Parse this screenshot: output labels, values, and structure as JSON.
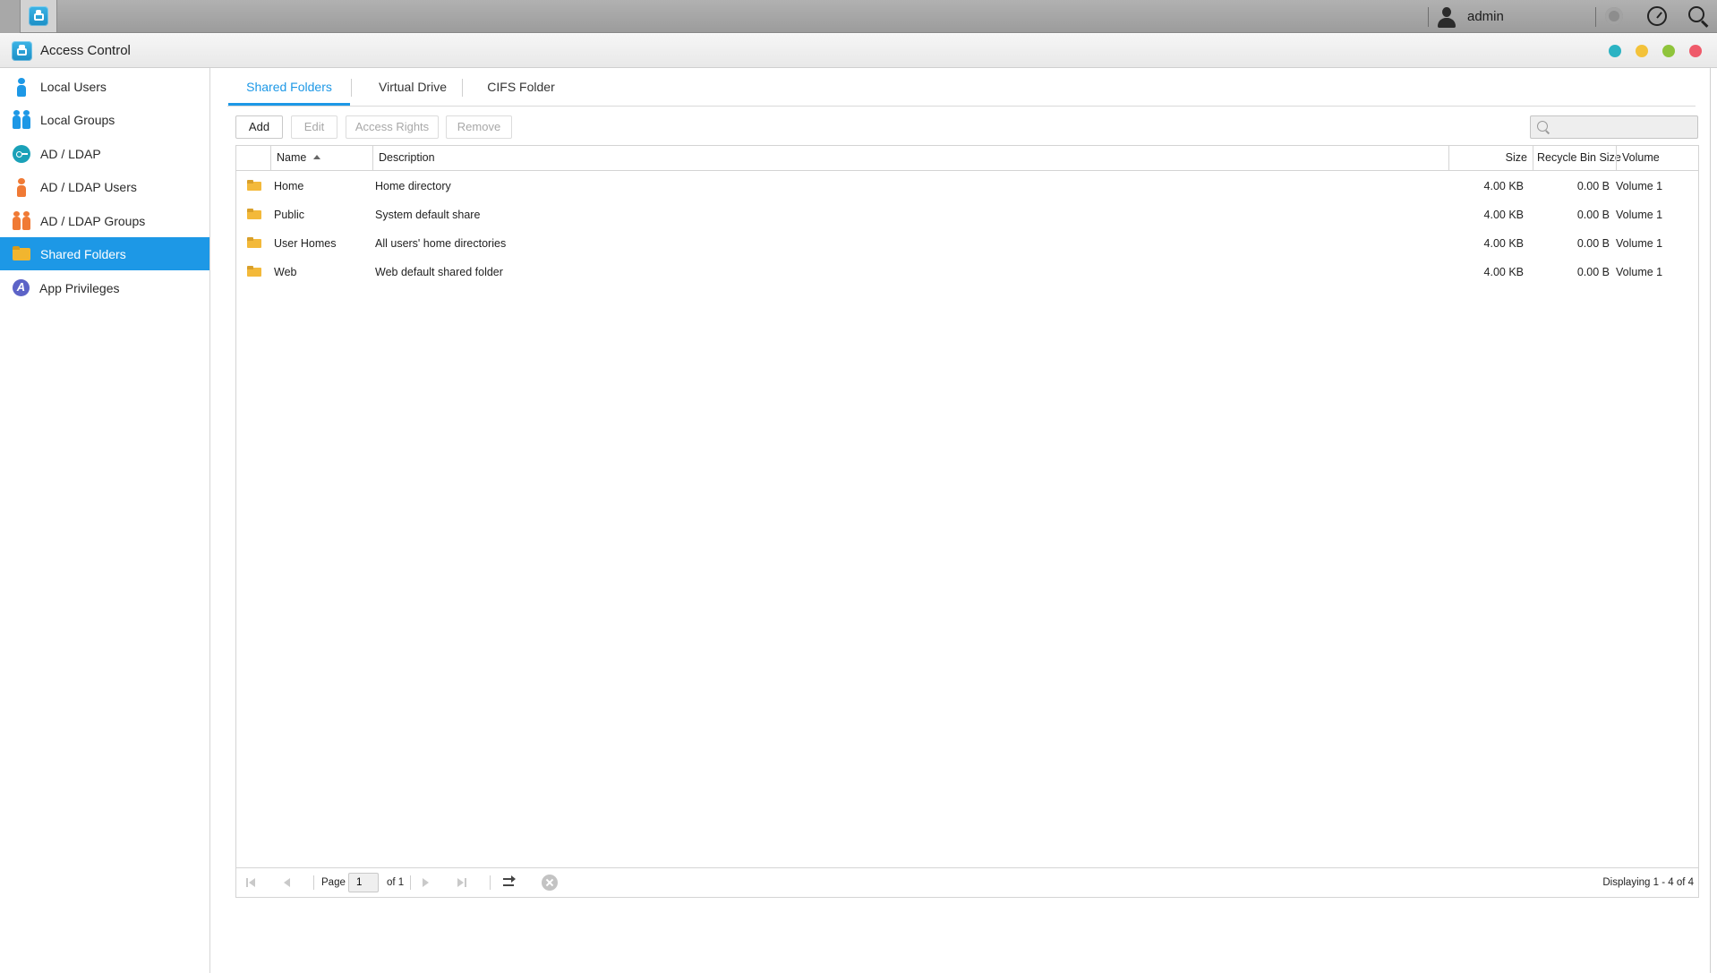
{
  "taskbar": {
    "username": "admin",
    "icons": [
      "access-control-app-icon",
      "user-icon",
      "notification-icon",
      "dashboard-gauge-icon",
      "search-icon"
    ]
  },
  "window": {
    "title": "Access Control",
    "controls": [
      {
        "name": "minimize",
        "color": "#2bb3c3"
      },
      {
        "name": "maximize",
        "color": "#f3c23a"
      },
      {
        "name": "restore",
        "color": "#8fc43b"
      },
      {
        "name": "close",
        "color": "#ef5a6a"
      }
    ]
  },
  "sidebar": {
    "items": [
      {
        "label": "Local Users",
        "icon": "person-icon",
        "color": "#1d98e6"
      },
      {
        "label": "Local Groups",
        "icon": "group-icon",
        "color": "#1d98e6"
      },
      {
        "label": "AD / LDAP",
        "icon": "key-icon",
        "color": "#1aa1b8"
      },
      {
        "label": "AD / LDAP Users",
        "icon": "person-icon",
        "color": "#f07a35"
      },
      {
        "label": "AD / LDAP Groups",
        "icon": "group-icon",
        "color": "#f07a35"
      },
      {
        "label": "Shared Folders",
        "icon": "folder-icon",
        "color": "#f1b52f",
        "active": true
      },
      {
        "label": "App Privileges",
        "icon": "app-privileges-icon",
        "color": "#5c63c7"
      }
    ]
  },
  "tabs": [
    {
      "label": "Shared Folders",
      "active": true
    },
    {
      "label": "Virtual Drive"
    },
    {
      "label": "CIFS Folder"
    }
  ],
  "toolbar": {
    "add": "Add",
    "edit": "Edit",
    "access_rights": "Access Rights",
    "remove": "Remove",
    "search_placeholder": ""
  },
  "table": {
    "columns": {
      "name": "Name",
      "description": "Description",
      "size": "Size",
      "recycle": "Recycle Bin Size",
      "volume": "Volume"
    },
    "sort": {
      "column": "Name",
      "direction": "ascending"
    },
    "rows": [
      {
        "name": "Home",
        "description": "Home directory",
        "size": "4.00 KB",
        "recycle": "0.00 B",
        "volume": "Volume 1"
      },
      {
        "name": "Public",
        "description": "System default share",
        "size": "4.00 KB",
        "recycle": "0.00 B",
        "volume": "Volume 1"
      },
      {
        "name": "User Homes",
        "description": "All users' home directories",
        "size": "4.00 KB",
        "recycle": "0.00 B",
        "volume": "Volume 1"
      },
      {
        "name": "Web",
        "description": "Web default shared folder",
        "size": "4.00 KB",
        "recycle": "0.00 B",
        "volume": "Volume 1"
      }
    ]
  },
  "pager": {
    "page_label": "Page",
    "page_value": "1",
    "of_label": "of 1",
    "display": "Displaying 1 - 4 of 4"
  },
  "colors": {
    "accent": "#1d98e6",
    "folder": "#f1b52f"
  }
}
